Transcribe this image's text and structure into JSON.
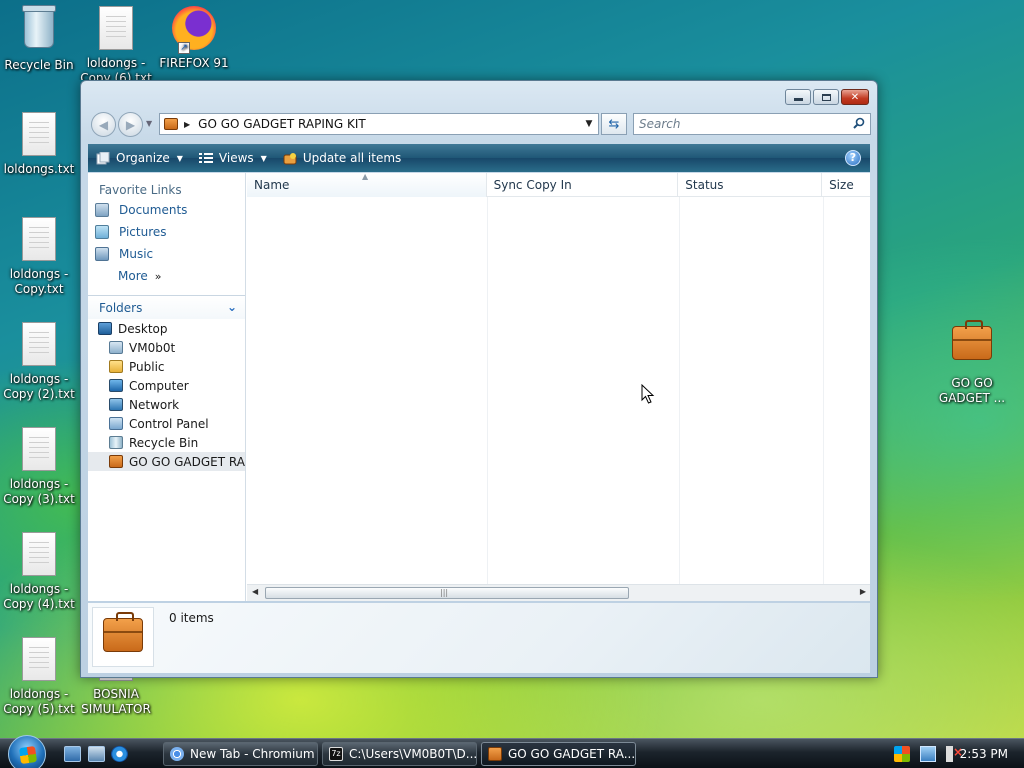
{
  "desktop": {
    "icons": [
      {
        "label": "Recycle Bin"
      },
      {
        "label": "loldongs - Copy (6).txt"
      },
      {
        "label": "FIREFOX 91"
      },
      {
        "label": "loldongs.txt"
      },
      {
        "label": "loldongs - Copy.txt"
      },
      {
        "label": "loldongs - Copy (2).txt"
      },
      {
        "label": "loldongs - Copy (3).txt"
      },
      {
        "label": "loldongs - Copy (4).txt"
      },
      {
        "label": "loldongs - Copy (5).txt"
      },
      {
        "label": "BOSNIA SIMULATOR"
      },
      {
        "label": "GO GO GADGET ..."
      }
    ]
  },
  "window": {
    "address": "GO GO GADGET RAPING KIT",
    "search_placeholder": "Search",
    "toolbar": {
      "organize": "Organize",
      "views": "Views",
      "update_all": "Update all items"
    },
    "nav_pane": {
      "favorite_links_title": "Favorite Links",
      "favorites": [
        "Documents",
        "Pictures",
        "Music"
      ],
      "more": "More",
      "folders_title": "Folders",
      "tree": [
        {
          "label": "Desktop",
          "level": 0
        },
        {
          "label": "VM0b0t",
          "level": 1
        },
        {
          "label": "Public",
          "level": 1
        },
        {
          "label": "Computer",
          "level": 1
        },
        {
          "label": "Network",
          "level": 1
        },
        {
          "label": "Control Panel",
          "level": 1
        },
        {
          "label": "Recycle Bin",
          "level": 1
        },
        {
          "label": "GO GO GADGET RAPI",
          "level": 1
        }
      ]
    },
    "columns": [
      "Name",
      "Sync Copy In",
      "Status",
      "Size"
    ],
    "details": {
      "count": "0 items"
    }
  },
  "taskbar": {
    "tasks": [
      {
        "label": "New Tab - Chromium"
      },
      {
        "label": "C:\\Users\\VM0B0T\\D..."
      },
      {
        "label": "GO GO GADGET RA..."
      }
    ],
    "clock": "2:53 PM"
  },
  "colors": {
    "link": "#1f5b93",
    "toolbar": "#1f5776",
    "close_button": "#c23a22"
  }
}
